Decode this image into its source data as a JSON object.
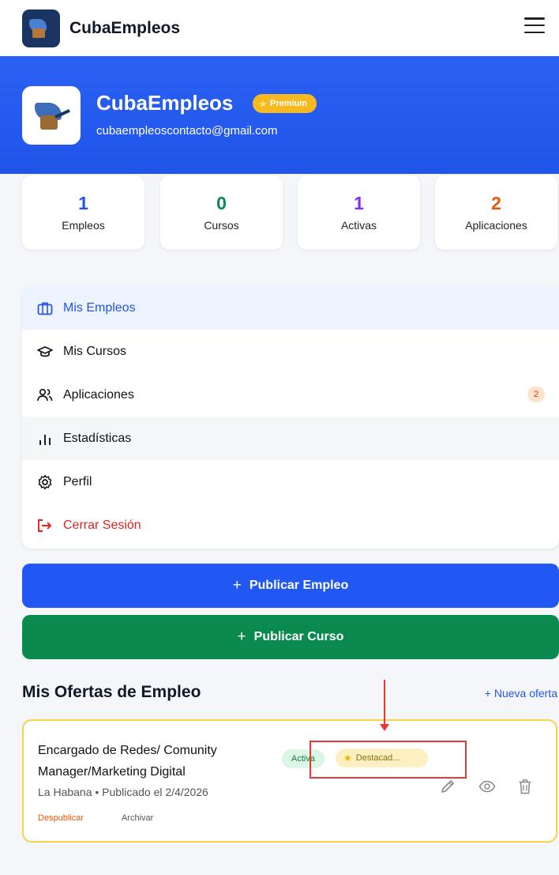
{
  "app": {
    "name": "CubaEmpleos",
    "accent": "#2157f2",
    "icons": {
      "logo": "briefcase-logo-icon",
      "menu": "hamburger-menu-icon"
    }
  },
  "profile": {
    "name": "CubaEmpleos",
    "badge": "Premium",
    "email": "cubaempleoscontacto@gmail.com"
  },
  "stats": [
    {
      "value": "1",
      "label": "Empleos",
      "color": "#2454e8"
    },
    {
      "value": "0",
      "label": "Cursos",
      "color": "#0a8a4e"
    },
    {
      "value": "1",
      "label": "Activas",
      "color": "#8b2cf5"
    },
    {
      "value": "2",
      "label": "Aplicaciones",
      "color": "#ea580c"
    }
  ],
  "menu": {
    "items": [
      {
        "label": "Mis Empleos",
        "icon": "briefcase-icon",
        "state": "active"
      },
      {
        "label": "Mis Cursos",
        "icon": "graduation-cap-icon"
      },
      {
        "label": "Aplicaciones",
        "icon": "users-icon",
        "count": "2"
      },
      {
        "label": "Estadísticas",
        "icon": "bar-chart-icon"
      },
      {
        "label": "Perfil",
        "icon": "settings-icon"
      },
      {
        "label": "Cerrar Sesión",
        "icon": "logout-icon",
        "color": "#e02424"
      }
    ]
  },
  "actions": {
    "publish_job": "Publicar Empleo",
    "publish_course": "Publicar Curso",
    "publish_job_color": "#2157f2",
    "publish_course_color": "#0a8a4e"
  },
  "offers": {
    "title": "Mis Ofertas de Empleo",
    "new_offer": "+ Nueva oferta",
    "items": [
      {
        "title": "Encargado de Redes/ Comunity Manager/Marketing Digital",
        "meta": "La Habana • Publicado el 2/4/2026",
        "status": "Activa",
        "featured": "Destacad...",
        "unpublish": "Despublicar",
        "archive": "Archivar",
        "icons": [
          "pencil-icon",
          "eye-icon",
          "trash-icon"
        ]
      }
    ]
  }
}
